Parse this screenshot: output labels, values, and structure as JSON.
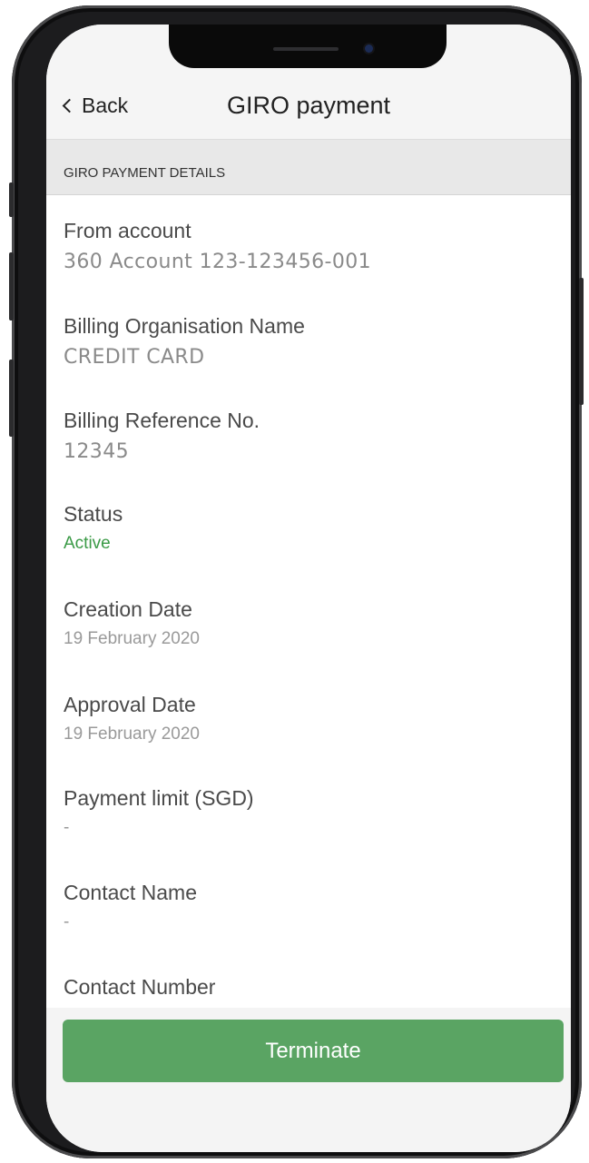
{
  "header": {
    "back_label": "Back",
    "title": "GIRO payment"
  },
  "section_title": "GIRO PAYMENT DETAILS",
  "fields": {
    "from_account": {
      "label": "From account",
      "value": "360 Account 123-123456-001"
    },
    "billing_org": {
      "label": "Billing Organisation Name",
      "value": "CREDIT CARD"
    },
    "billing_ref": {
      "label": "Billing Reference No.",
      "value": "12345"
    },
    "status": {
      "label": "Status",
      "value": "Active"
    },
    "creation_date": {
      "label": "Creation Date",
      "value": "19 February 2020"
    },
    "approval_date": {
      "label": "Approval Date",
      "value": "19 February 2020"
    },
    "payment_limit": {
      "label": "Payment limit (SGD)",
      "value": "-"
    },
    "contact_name": {
      "label": "Contact Name",
      "value": "-"
    },
    "contact_number": {
      "label": "Contact Number",
      "value": "-"
    }
  },
  "footer": {
    "terminate_label": "Terminate"
  },
  "colors": {
    "status_active": "#3a9a46",
    "button_green": "#5aa463"
  }
}
